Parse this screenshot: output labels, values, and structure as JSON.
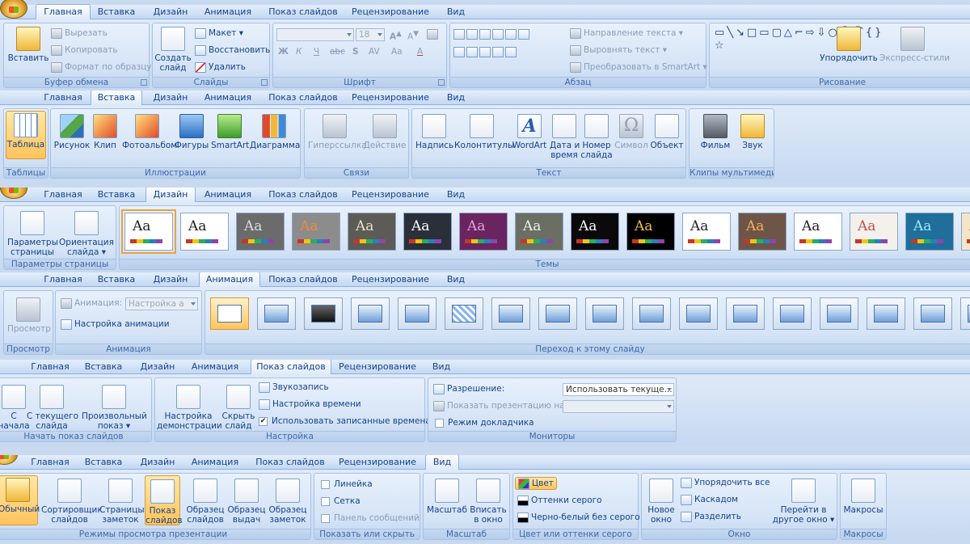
{
  "tabs": [
    "Главная",
    "Вставка",
    "Дизайн",
    "Анимация",
    "Показ слайдов",
    "Рецензирование",
    "Вид"
  ],
  "home": {
    "clipboard": {
      "paste": "Вставить",
      "cut": "Вырезать",
      "copy": "Копировать",
      "format": "Формат по образцу",
      "label": "Буфер обмена"
    },
    "slides": {
      "create": "Создать слайд",
      "layout": "Макет",
      "reset": "Восстановить",
      "delete": "Удалить",
      "label": "Слайды"
    },
    "font": {
      "size": "18",
      "label": "Шрифт",
      "bold": "Ж",
      "italic": "К",
      "under": "Ч",
      "strike": "abc",
      "shadow": "S",
      "spacing": "AV",
      "case": "Aa",
      "color": "A",
      "grow": "A",
      "shrink": "A"
    },
    "para": {
      "dir": "Направление текста",
      "align": "Выровнять текст",
      "smart": "Преобразовать в SmartArt",
      "label": "Абзац"
    },
    "draw": {
      "arrange": "Упорядочить",
      "styles": "Экспресс-стили",
      "label": "Рисование"
    }
  },
  "insert": {
    "tables": {
      "table": "Таблица",
      "label": "Таблицы"
    },
    "illus": {
      "picture": "Рисунок",
      "clip": "Клип",
      "album": "Фотоальбом",
      "shapes": "Фигуры",
      "smart": "SmartArt",
      "chart": "Диаграмма",
      "label": "Иллюстрации"
    },
    "links": {
      "hyper": "Гиперссылка",
      "action": "Действие",
      "label": "Связи"
    },
    "text": {
      "caption": "Надпись",
      "headers": "Колонтитулы",
      "wordart": "WordArt",
      "date1": "Дата и",
      "date2": "время",
      "num1": "Номер",
      "num2": "слайда",
      "symbol": "Символ",
      "object": "Объект",
      "label": "Текст"
    },
    "media": {
      "film": "Фильм",
      "sound": "Звук",
      "label": "Клипы мультимедиа"
    }
  },
  "design": {
    "page": {
      "params1": "Параметры",
      "params2": "страницы",
      "orient1": "Ориентация",
      "orient2": "слайда",
      "label": "Параметры страницы"
    },
    "themes_label": "Темы",
    "themes": [
      {
        "t": "Aa",
        "bg": "#ffffff",
        "fg": "#222222",
        "sel": true
      },
      {
        "t": "Aa",
        "bg": "#ffffff",
        "fg": "#222222"
      },
      {
        "t": "Aa",
        "bg": "#6b6b6b",
        "fg": "#dddddd"
      },
      {
        "t": "Aa",
        "bg": "#8c8c8c",
        "fg": "#f08a3c"
      },
      {
        "t": "Aa",
        "bg": "#5d5b55",
        "fg": "#e8e2c8"
      },
      {
        "t": "Aa",
        "bg": "#2b2f3a",
        "fg": "#ffffff"
      },
      {
        "t": "Aa",
        "bg": "#6a2460",
        "fg": "#e8a0d8"
      },
      {
        "t": "Aa",
        "bg": "#6b6f63",
        "fg": "#eeeeee"
      },
      {
        "t": "Aa",
        "bg": "#0a0a0a",
        "fg": "#ffffff"
      },
      {
        "t": "Aa",
        "bg": "#000000",
        "fg": "#f0c040"
      },
      {
        "t": "Aa",
        "bg": "#ffffff",
        "fg": "#222222"
      },
      {
        "t": "Aa",
        "bg": "#6e5548",
        "fg": "#f4b060"
      },
      {
        "t": "Aa",
        "bg": "#ffffff",
        "fg": "#222222"
      },
      {
        "t": "Aa",
        "bg": "#f4f0ec",
        "fg": "#c0504d"
      },
      {
        "t": "Aa",
        "bg": "#1f6f9a",
        "fg": "#9fe8ff"
      },
      {
        "t": "A",
        "bg": "#f3e6c8",
        "fg": "#444444"
      }
    ]
  },
  "anim": {
    "preview": "Просмотр",
    "preview_label": "Просмотр",
    "anim_label": "Анимация:",
    "anim_value": "Настройка а",
    "setup": "Настройка анимации",
    "label": "Анимация",
    "trans_label": "Переход к этому слайду"
  },
  "show": {
    "start": {
      "from1": "С",
      "from2": "начала",
      "cur1": "С текущего",
      "cur2": "слайда",
      "custom1": "Произвольный",
      "custom2": "показ",
      "label": "Начать показ слайдов"
    },
    "setup": {
      "demo1": "Настройка",
      "demo2": "демонстрации",
      "hide1": "Скрыть",
      "hide2": "слайд",
      "rec": "Звукозапись",
      "timing": "Настройка времени",
      "use": "Использовать записанные времена",
      "label": "Настройка"
    },
    "mon": {
      "res": "Разрешение:",
      "res_value": "Использовать текуще...",
      "on": "Показать презентацию на:",
      "presenter": "Режим докладчика",
      "label": "Мониторы"
    }
  },
  "view": {
    "modes": {
      "normal": "Обычный",
      "sorter1": "Сортировщик",
      "sorter2": "слайдов",
      "notes1": "Страницы",
      "notes2": "заметок",
      "show1": "Показ",
      "show2": "слайдов",
      "sm1": "Образец",
      "sm2": "слайдов",
      "hm1": "Образец",
      "hm2": "выдач",
      "nm1": "Образец",
      "nm2": "заметок",
      "label": "Режимы просмотра презентации"
    },
    "show": {
      "ruler": "Линейка",
      "grid": "Сетка",
      "msg": "Панель сообщений",
      "label": "Показать или скрыть"
    },
    "zoom": {
      "zoom": "Масштаб",
      "fit1": "Вписать",
      "fit2": "в окно",
      "label": "Масштаб"
    },
    "color": {
      "color": "Цвет",
      "gray": "Оттенки серого",
      "bw": "Черно-белый без серого",
      "label": "Цвет или оттенки серого"
    },
    "window": {
      "new1": "Новое",
      "new2": "окно",
      "arrange": "Упорядочить все",
      "cascade": "Каскадом",
      "split": "Разделить",
      "switch1": "Перейти в",
      "switch2": "другое окно",
      "label": "Окно"
    },
    "macro": {
      "macros": "Макросы",
      "label": "Макросы"
    }
  }
}
